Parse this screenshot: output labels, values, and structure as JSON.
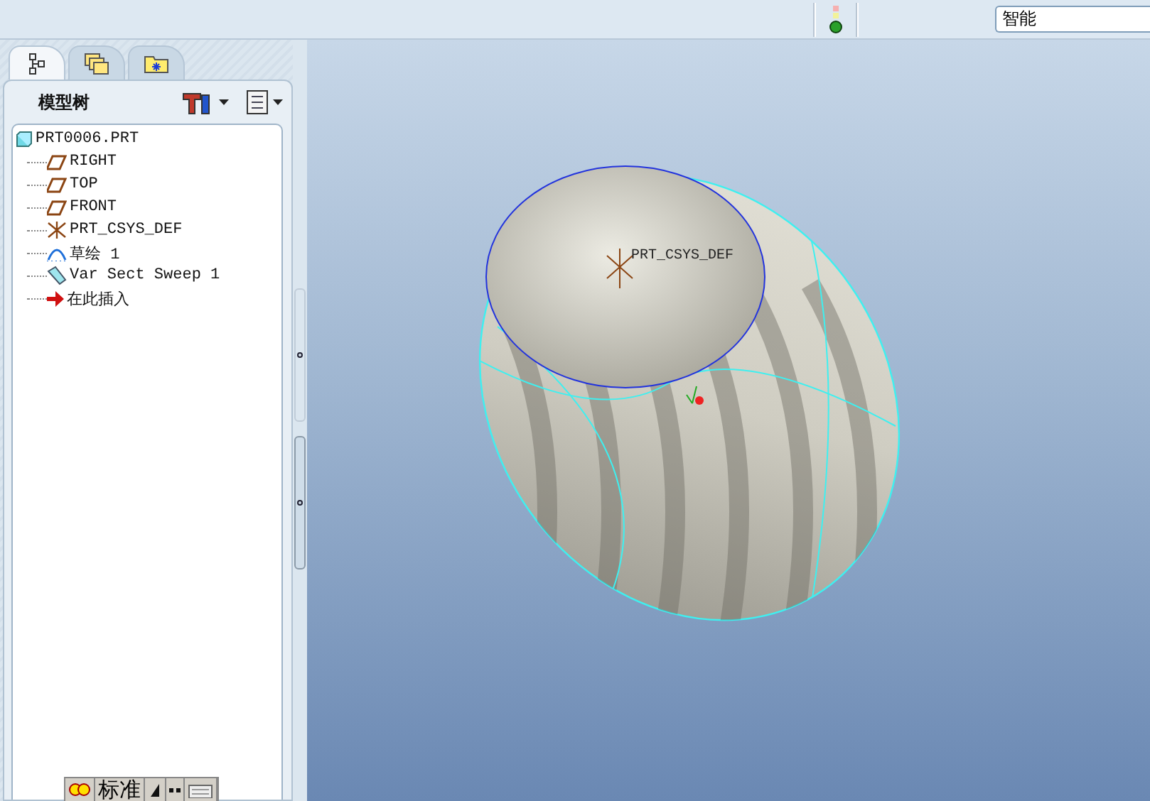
{
  "toolbar": {
    "search_field": {
      "value": "智能"
    }
  },
  "navigator": {
    "tabs": [
      {
        "kind": "tree",
        "selected": true
      },
      {
        "kind": "layers",
        "selected": false
      },
      {
        "kind": "folder",
        "selected": false
      }
    ],
    "title": "模型树",
    "tree": {
      "label": "PRT0006.PRT",
      "kind": "part",
      "children": [
        {
          "label": "RIGHT",
          "kind": "plane"
        },
        {
          "label": "TOP",
          "kind": "plane"
        },
        {
          "label": "FRONT",
          "kind": "plane"
        },
        {
          "label": "PRT_CSYS_DEF",
          "kind": "csys"
        },
        {
          "label": "草绘 1",
          "kind": "sketch"
        },
        {
          "label": "Var Sect Sweep 1",
          "kind": "sweep"
        },
        {
          "label": "在此插入",
          "kind": "insert"
        }
      ]
    }
  },
  "canvas": {
    "csys_label": "PRT_CSYS_DEF"
  },
  "ime_bar": {
    "mode": "标准"
  }
}
